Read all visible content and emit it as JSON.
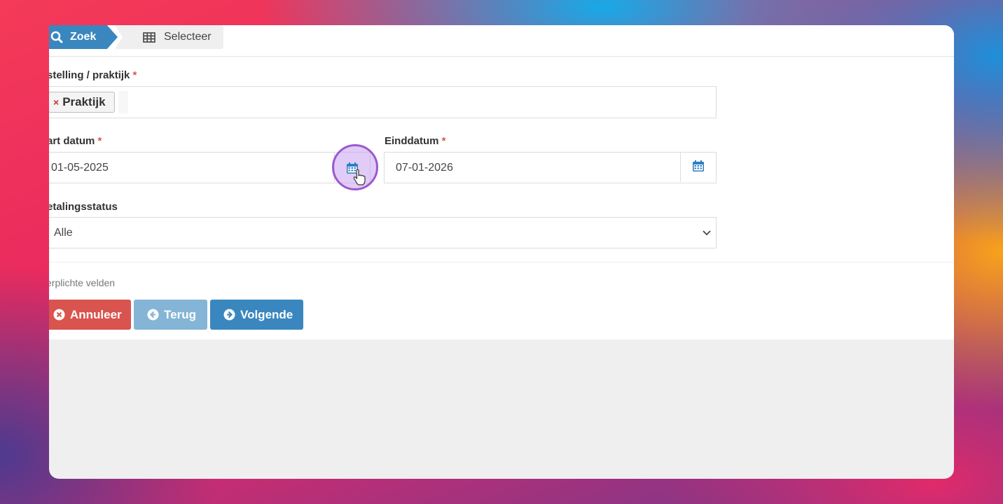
{
  "steps": {
    "zoek": "Zoek",
    "selecteer": "Selecteer"
  },
  "form": {
    "instelling": {
      "label": "stelling / praktijk",
      "required": "*",
      "tag": "Praktijk",
      "tag_remove": "×"
    },
    "startdatum": {
      "label": "art datum",
      "required": "*",
      "value": "01-05-2025"
    },
    "einddatum": {
      "label": "Einddatum",
      "required": "*",
      "value": "07-01-2026"
    },
    "betalingsstatus": {
      "label": "etalingsstatus",
      "value": "Alle"
    },
    "hint": "erplichte velden"
  },
  "buttons": {
    "annuleer": "Annuleer",
    "terug": "Terug",
    "volgende": "Volgende"
  },
  "colors": {
    "primary": "#3a87bf",
    "danger": "#d9534f",
    "disabled": "#85b5d6",
    "calendar_icon": "#2f7fc1"
  }
}
